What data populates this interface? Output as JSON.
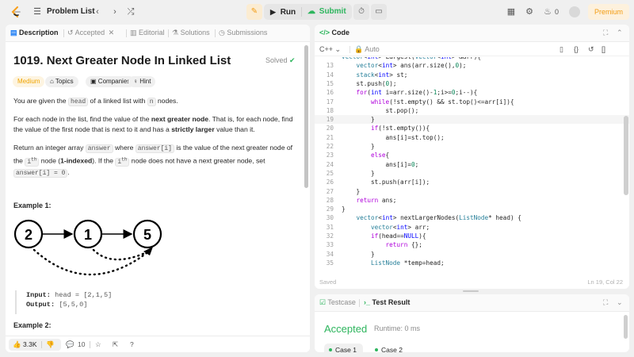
{
  "topbar": {
    "problem_list_label": "Problem List",
    "run_label": "Run",
    "submit_label": "Submit",
    "notifications_count": "0",
    "premium_label": "Premium"
  },
  "description_tabs": [
    {
      "label": "Description",
      "icon": "description-icon"
    },
    {
      "label": "Accepted",
      "icon": "history-icon"
    },
    {
      "label": "Editorial",
      "icon": "book-icon"
    },
    {
      "label": "Solutions",
      "icon": "flask-icon"
    },
    {
      "label": "Submissions",
      "icon": "clock-icon"
    }
  ],
  "problem": {
    "title": "1019. Next Greater Node In Linked List",
    "status": "Solved",
    "difficulty": "Medium",
    "chips": [
      "Topics",
      "Companies",
      "Hint"
    ],
    "p1_a": "You are given the ",
    "p1_code": "head",
    "p1_b": " of a linked list with ",
    "p1_code2": "n",
    "p1_c": " nodes.",
    "p2_a": "For each node in the list, find the value of the ",
    "p2_bold": "next greater node",
    "p2_b": ". That is, for each node, find the value of the first node that is next to it and has a ",
    "p2_bold2": "strictly larger",
    "p2_c": " value than it.",
    "p3_a": "Return an integer array ",
    "p3_code": "answer",
    "p3_b": " where ",
    "p3_code2": "answer[i]",
    "p3_c": " is the value of the next greater node of the ",
    "p3_ith": "i",
    "p3_sup": "th",
    "p3_d": " node (",
    "p3_bold": "1-indexed",
    "p3_e": "). If the ",
    "p3_ith2": "i",
    "p3_sup2": "th",
    "p3_f": " node does not have a next greater node, set ",
    "p3_code3": "answer[i] = 0",
    "p3_g": ".",
    "example1_title": "Example 1:",
    "example1_nodes": [
      "2",
      "1",
      "5"
    ],
    "example1_input_label": "Input:",
    "example1_input": "head = [2,1,5]",
    "example1_output_label": "Output:",
    "example1_output": "[5,5,0]",
    "example2_title": "Example 2:"
  },
  "footer": {
    "likes": "3.3K",
    "comments": "10"
  },
  "code_panel": {
    "title": "Code",
    "language": "C++",
    "mode": "Auto",
    "status_left": "Saved",
    "status_right": "Ln 19, Col 22"
  },
  "code_lines": [
    {
      "n": "",
      "text": "vector<int> Largest(vector<int> &arr){"
    },
    {
      "n": "13",
      "text": "    vector<int> ans(arr.size(),0);"
    },
    {
      "n": "14",
      "text": "    stack<int> st;"
    },
    {
      "n": "15",
      "text": "    st.push(0);"
    },
    {
      "n": "16",
      "text": "    for(int i=arr.size()-1;i>=0;i--){"
    },
    {
      "n": "17",
      "text": "        while(!st.empty() && st.top()<=arr[i]){"
    },
    {
      "n": "18",
      "text": "            st.pop();"
    },
    {
      "n": "19",
      "text": "        }"
    },
    {
      "n": "20",
      "text": "        if(!st.empty()){"
    },
    {
      "n": "21",
      "text": "            ans[i]=st.top();"
    },
    {
      "n": "22",
      "text": "        }"
    },
    {
      "n": "23",
      "text": "        else{"
    },
    {
      "n": "24",
      "text": "            ans[i]=0;"
    },
    {
      "n": "25",
      "text": "        }"
    },
    {
      "n": "26",
      "text": "        st.push(arr[i]);"
    },
    {
      "n": "27",
      "text": "    }"
    },
    {
      "n": "28",
      "text": "    return ans;"
    },
    {
      "n": "29",
      "text": "}"
    },
    {
      "n": "30",
      "text": "    vector<int> nextLargerNodes(ListNode* head) {"
    },
    {
      "n": "31",
      "text": "        vector<int> arr;"
    },
    {
      "n": "32",
      "text": "        if(head==NULL){"
    },
    {
      "n": "33",
      "text": "            return {};"
    },
    {
      "n": "34",
      "text": "        }"
    },
    {
      "n": "35",
      "text": "        ListNode *temp=head;"
    }
  ],
  "result_panel": {
    "tab_testcase": "Testcase",
    "tab_result": "Test Result",
    "verdict": "Accepted",
    "runtime": "Runtime: 0 ms",
    "cases": [
      "Case 1",
      "Case 2"
    ]
  },
  "colors": {
    "accent_green": "#2db55d",
    "difficulty_medium": "#f0a400",
    "premium": "#f39c12"
  }
}
